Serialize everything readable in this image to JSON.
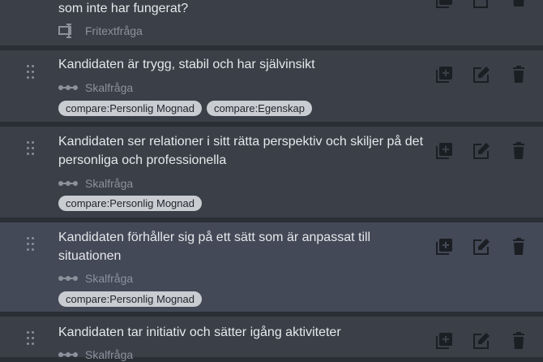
{
  "items": [
    {
      "text": "som inte har fungerat?",
      "type_label": "Fritextfråga",
      "type_icon": "free-text-icon",
      "tags": []
    },
    {
      "text": "Kandidaten är trygg, stabil och har självinsikt",
      "type_label": "Skalfråga",
      "type_icon": "scale-icon",
      "tags": [
        "compare:Personlig Mognad",
        "compare:Egenskap"
      ]
    },
    {
      "text": "Kandidaten ser relationer i sitt rätta perspektiv och skiljer på det personliga och professionella",
      "type_label": "Skalfråga",
      "type_icon": "scale-icon",
      "tags": [
        "compare:Personlig Mognad"
      ]
    },
    {
      "text": "Kandidaten förhåller sig på ett sätt som är anpassat till situationen",
      "type_label": "Skalfråga",
      "type_icon": "scale-icon",
      "tags": [
        "compare:Personlig Mognad"
      ]
    },
    {
      "text": "Kandidaten tar initiativ och sätter igång aktiviteter",
      "type_label": "Skalfråga",
      "type_icon": "scale-icon",
      "tags": []
    }
  ],
  "actions": {
    "duplicate_icon": "duplicate-icon",
    "edit_icon": "edit-icon",
    "delete_icon": "trash-icon"
  },
  "colors": {
    "background": "#2a2e35",
    "card": "#3a3f48",
    "card_hover": "#434957",
    "tag_bg": "#c9ccd1",
    "icon": "#1b1e23"
  }
}
